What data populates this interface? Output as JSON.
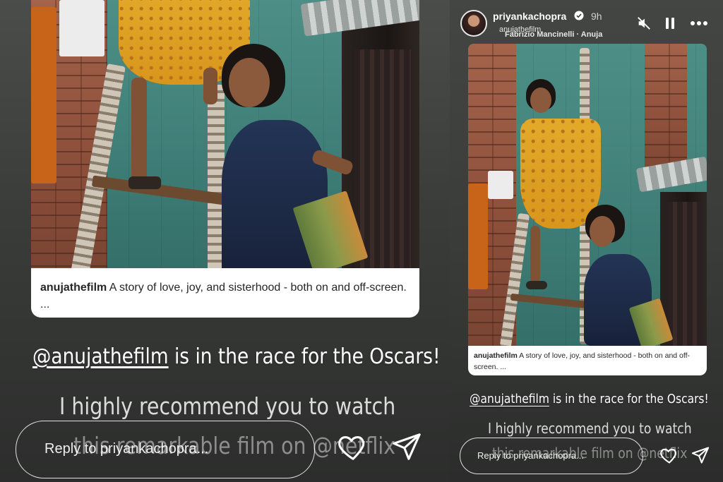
{
  "story_header": {
    "username": "priyankachopra",
    "time": "9h",
    "tagged_account": "anujathefilm",
    "music": "Fabrizio Mancinelli · Anuja"
  },
  "caption": {
    "username": "anujathefilm",
    "text": " A story of love, joy, and sisterhood - both on and off-screen. ..."
  },
  "overlay": {
    "mention": "@anujathefilm",
    "line1_rest": " is in the race for the Oscars!",
    "line2_a": "I highly recommend you to watch",
    "line2_b": "this remarkable film on @netflix"
  },
  "reply": {
    "placeholder": "Reply to priyankachopra..."
  },
  "icons": [
    "verified-icon",
    "mute-icon",
    "pause-icon",
    "more-icon",
    "heart-icon",
    "send-icon"
  ]
}
